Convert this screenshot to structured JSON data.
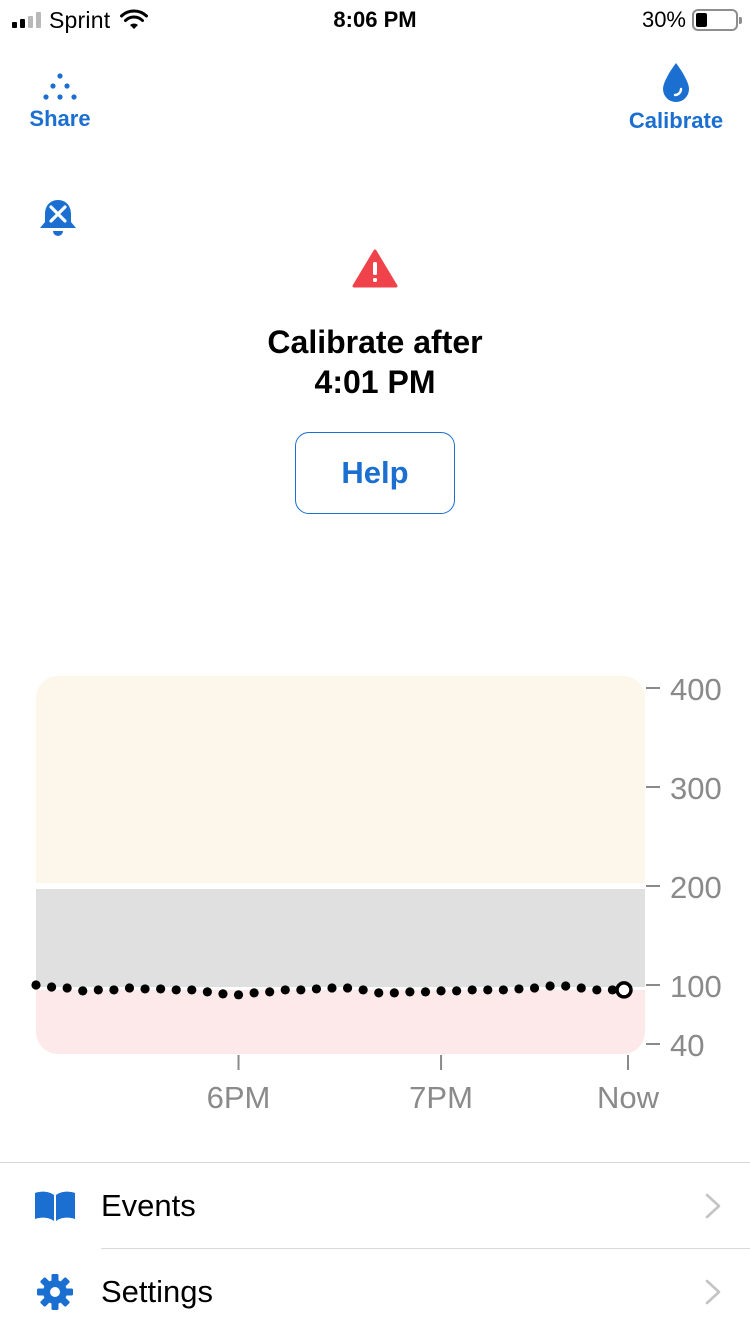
{
  "status_bar": {
    "carrier": "Sprint",
    "time": "8:06 PM",
    "battery_percent": "30%",
    "battery_level": 0.3,
    "signal_bars_filled": 2,
    "signal_bars_total": 4
  },
  "toolbar": {
    "share_label": "Share",
    "calibrate_label": "Calibrate"
  },
  "alert": {
    "title_line1": "Calibrate after",
    "title_line2": "4:01 PM",
    "help_label": "Help"
  },
  "colors": {
    "accent": "#1a6fd0",
    "alert_red": "#f0424a",
    "zone_high": "#fdf6ea",
    "zone_target": "#e0e0e0",
    "zone_low": "#fde9ea",
    "axis_text": "#8a8a8a"
  },
  "chart_data": {
    "type": "scatter",
    "y_ticks": [
      400,
      300,
      200,
      100,
      40
    ],
    "y_tick_labels": [
      "400",
      "300",
      "200",
      "100",
      "40"
    ],
    "x_tick_labels": [
      "6PM",
      "7PM",
      "Now"
    ],
    "x_tick_minutes_before_now": [
      125,
      60,
      0
    ],
    "x_range_minutes_before_now": [
      190,
      0
    ],
    "ylim": [
      40,
      400
    ],
    "zones": [
      {
        "name": "high",
        "from": 200,
        "to": 400
      },
      {
        "name": "target",
        "from": 100,
        "to": 200
      },
      {
        "name": "low",
        "from": 40,
        "to": 95
      }
    ],
    "x_minutes_before_now": [
      190,
      185,
      180,
      175,
      170,
      165,
      160,
      155,
      150,
      145,
      140,
      135,
      130,
      125,
      120,
      115,
      110,
      105,
      100,
      95,
      90,
      85,
      80,
      75,
      70,
      65,
      60,
      55,
      50,
      45,
      40,
      35,
      30,
      25,
      20,
      15,
      10,
      5,
      0
    ],
    "values": [
      100,
      98,
      97,
      94,
      95,
      95,
      97,
      96,
      96,
      95,
      95,
      93,
      91,
      90,
      92,
      93,
      95,
      95,
      96,
      97,
      97,
      95,
      92,
      92,
      93,
      93,
      94,
      94,
      95,
      95,
      95,
      96,
      97,
      99,
      99,
      97,
      95,
      95,
      95
    ],
    "current_value": 95
  },
  "list": {
    "events_label": "Events",
    "settings_label": "Settings"
  }
}
